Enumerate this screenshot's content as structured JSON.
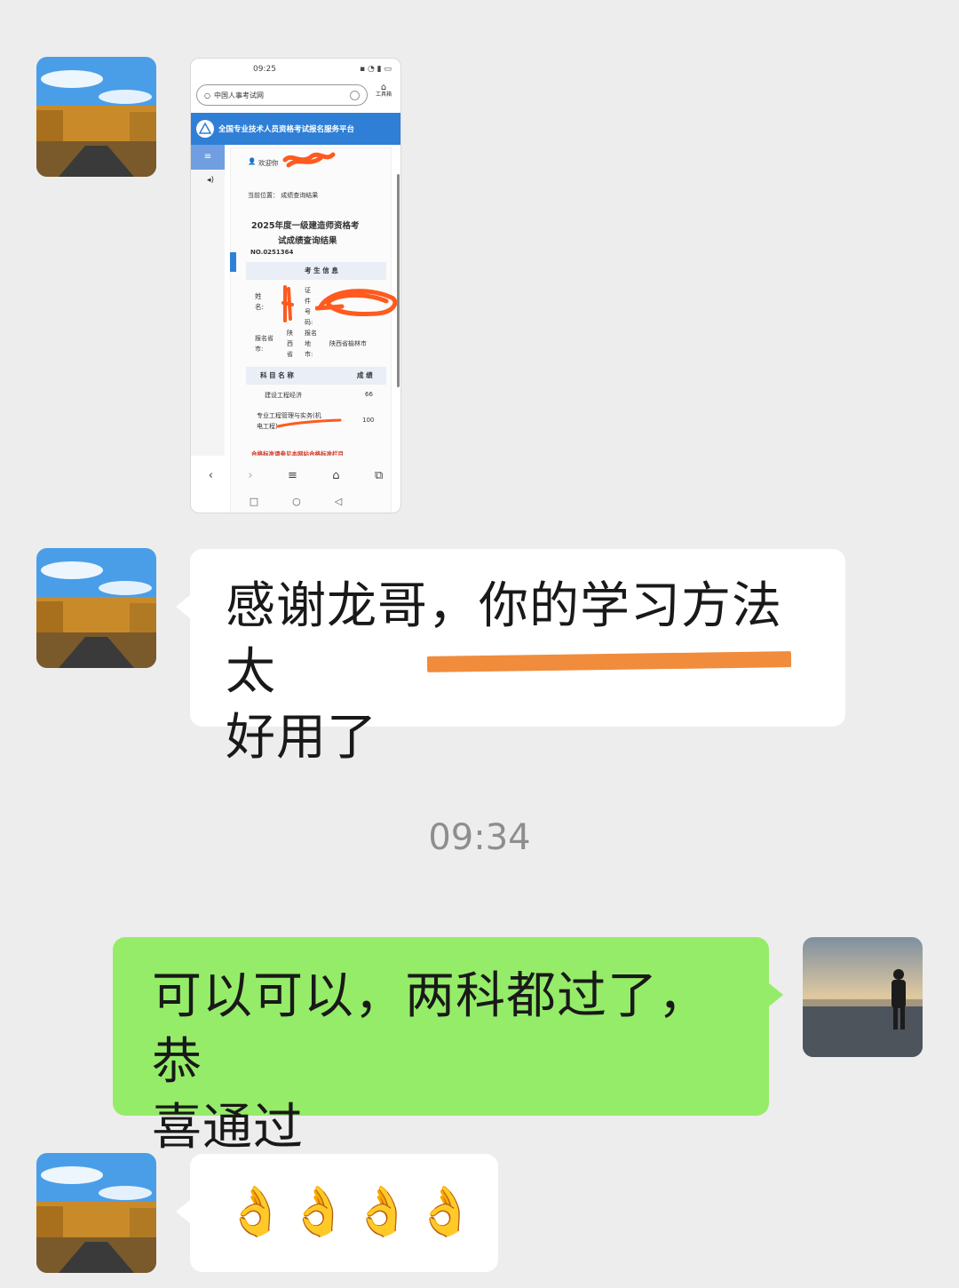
{
  "chat": {
    "timestamp": "09:34",
    "messages": [
      {
        "from": "other",
        "type": "image"
      },
      {
        "from": "other",
        "type": "text",
        "text": "感谢龙哥，你的学习方法太好用了",
        "line1": "感谢龙哥，你的学习方法太",
        "line2": "好用了"
      },
      {
        "from": "self",
        "type": "text",
        "text": "可以可以，两科都过了，恭喜通过",
        "line1": "可以可以，两科都过了，恭",
        "line2": "喜通过"
      },
      {
        "from": "other",
        "type": "emoji",
        "text": "👌👌👌👌"
      }
    ]
  },
  "screenshot": {
    "status_time": "09:25",
    "search_text": "中国人事考试网",
    "toolbox_label": "工具箱",
    "banner_title": "全国专业技术人员资格考试报名服务平台",
    "welcome": "欢迎你",
    "breadcrumb": "当前位置：  成绩查询结果",
    "title_line1": "2025年度一级建造师资格考",
    "title_line2": "试成绩查询结果",
    "number": "NO.0251364",
    "section_title": "考 生 信 息",
    "name_label": "姓名:",
    "id_label": "证件号码:",
    "province_label": "报名省市:",
    "province_value": "陕西省",
    "city_label": "报名地市:",
    "city_value": "陕西省榆林市",
    "subject_header": "科 目 名 称",
    "score_header": "成 绩",
    "subjects": [
      {
        "name": "建设工程经济",
        "score": "66"
      },
      {
        "name": "专业工程管理与实务(机电工程)",
        "score": "100"
      }
    ],
    "footer_note": "合格标准请参见本网站合格标准栏目"
  },
  "colors": {
    "background": "#ededed",
    "bubble_white": "#ffffff",
    "bubble_green": "#95ec69",
    "highlight_underline": "#f08c3c",
    "redaction": "#ff5a1f"
  }
}
